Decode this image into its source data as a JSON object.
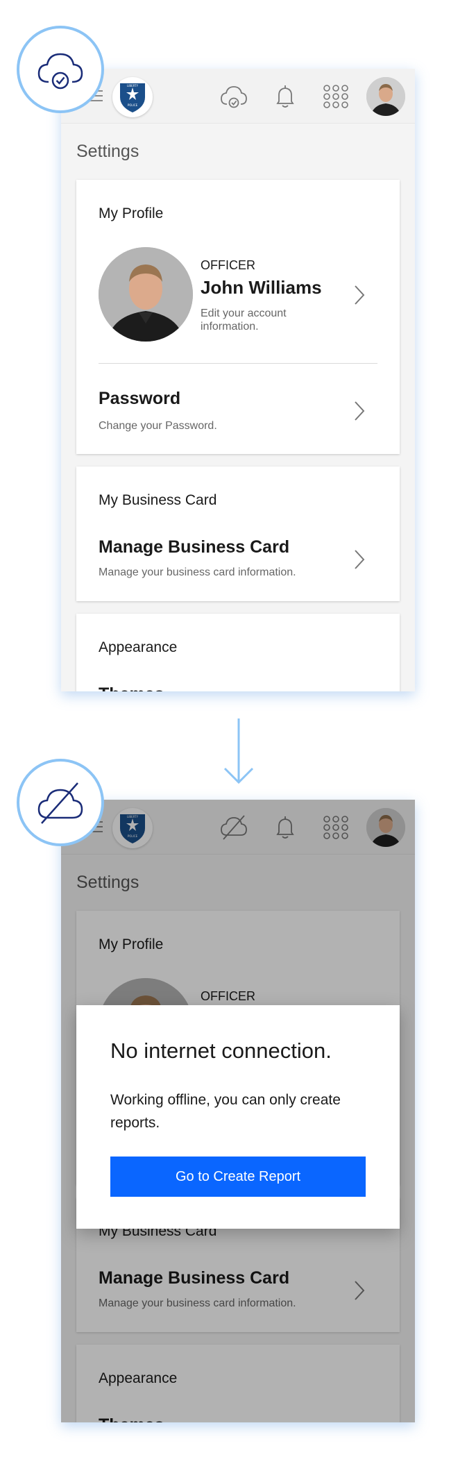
{
  "colors": {
    "accent": "#0a66ff",
    "badge_ring": "#8cc4f5",
    "badge_icon": "#1a2c78",
    "screen_shadow": "#9ec9f3",
    "overlay": "rgba(0,0,0,0.3)"
  },
  "icons": {
    "status_online": "cloud-check-icon",
    "status_offline": "cloud-off-icon",
    "menu": "hamburger-menu-icon",
    "logo": "liberty-police-badge-logo",
    "notifications": "bell-icon",
    "apps": "grid-apps-icon",
    "avatar": "user-avatar",
    "row_action": "chevron-right-icon",
    "flow": "arrow-down-icon"
  },
  "topbar": {
    "logo_text": [
      "LIBERTY",
      "POLICE"
    ]
  },
  "online_screen": {
    "page_title": "Settings",
    "profile": {
      "section_title": "My Profile",
      "rank": "OFFICER",
      "name": "John Williams",
      "edit_desc": "Edit your account information.",
      "password_title": "Password",
      "password_desc": "Change your Password."
    },
    "business": {
      "section_title": "My Business Card",
      "row_title": "Manage Business Card",
      "row_desc": "Manage your business card information."
    },
    "appearance": {
      "section_title": "Appearance",
      "row_title": "Themes"
    }
  },
  "offline_screen": {
    "page_title": "Settings",
    "profile": {
      "section_title": "My Profile",
      "rank": "OFFICER"
    },
    "business": {
      "section_title": "My Business Card",
      "row_title": "Manage Business Card",
      "row_desc": "Manage your business card information."
    },
    "appearance": {
      "section_title": "Appearance",
      "row_title": "Themes"
    },
    "dialog": {
      "title": "No internet connection.",
      "body": "Working offline, you can only create reports.",
      "button_label": "Go to Create Report"
    }
  }
}
